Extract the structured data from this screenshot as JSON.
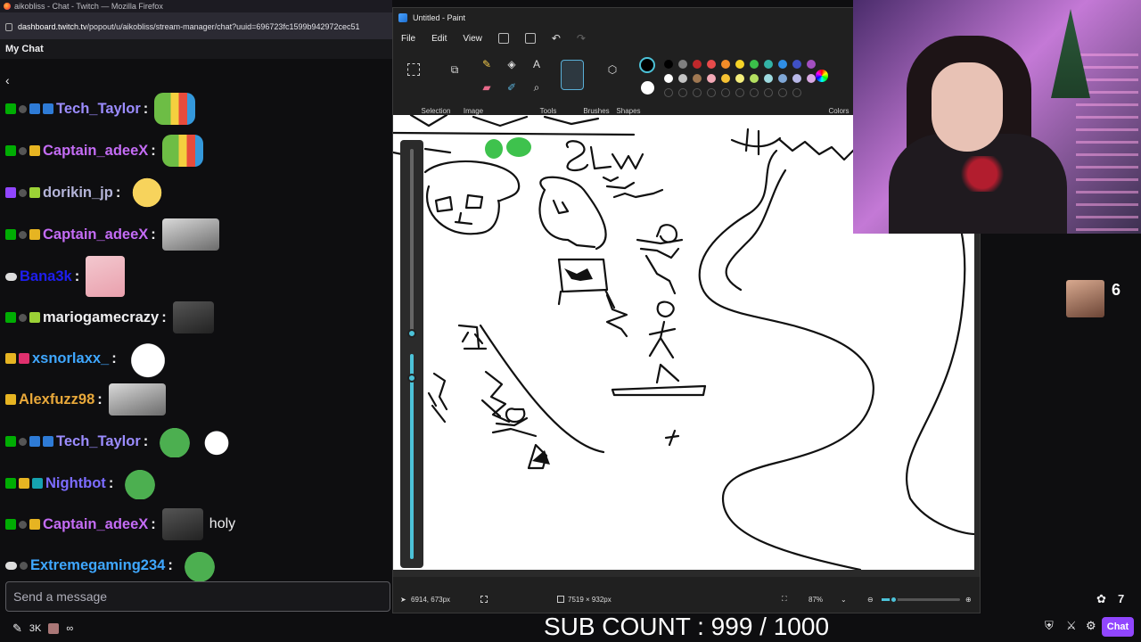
{
  "browser": {
    "title": "aikobliss - Chat - Twitch — Mozilla Firefox",
    "url_domain": "dashboard.twitch.tv",
    "url_path": "/popout/u/aikobliss/stream-manager/chat?uuid=696723fc1599b942972cec51"
  },
  "chat": {
    "header": "My Chat",
    "back_icon": "chevron-left-icon",
    "messages": [
      {
        "user": "Tech_Taylor",
        "color": "#9b8cff",
        "text": "",
        "emote": "rainbow-pepe-emote"
      },
      {
        "user": "Captain_adeeX",
        "color": "#c46cf5",
        "text": "",
        "emote": "rainbow-pepe-emote"
      },
      {
        "user": "dorikin_jp",
        "color": "#b4b4d8",
        "text": "",
        "emote": "cat-emote"
      },
      {
        "user": "Captain_adeeX",
        "color": "#c46cf5",
        "text": "",
        "emote": "man-headset-emote"
      },
      {
        "user": "Bana3k",
        "color": "#1e1ef0",
        "text": "",
        "emote": "kitten-emote"
      },
      {
        "user": "mariogamecrazy",
        "color": "#efeff1",
        "text": "",
        "emote": "stare-emote"
      },
      {
        "user": "xsnorlaxx_",
        "color": "#3fa7ff",
        "text": "",
        "emote": "ghost-emote"
      },
      {
        "user": "Alexfuzz98",
        "color": "#e8a83a",
        "text": "",
        "emote": "man-headset-emote"
      },
      {
        "user": "Tech_Taylor",
        "color": "#9b8cff",
        "text": "",
        "emote": "pepe-wave-emote"
      },
      {
        "user": "Nightbot",
        "color": "#7c6cff",
        "text": "",
        "emote": "pepe-emote"
      },
      {
        "user": "Captain_adeeX",
        "color": "#c46cf5",
        "text": "holy",
        "emote": "stare-emote"
      },
      {
        "user": "Extremegaming234",
        "color": "#3fa7ff",
        "text": "",
        "emote": "pepe-emote"
      }
    ],
    "input_placeholder": "Send a message",
    "footer_count": "3K",
    "footer_infinity": "∞"
  },
  "paint": {
    "title": "Untitled - Paint",
    "menu": [
      "File",
      "Edit",
      "View"
    ],
    "groups": {
      "selection": "Selection",
      "image": "Image",
      "tools": "Tools",
      "brushes": "Brushes",
      "shapes": "Shapes",
      "colors": "Colors"
    },
    "status": {
      "cursor": "6914, 673px",
      "canvas_size": "7519 × 932px",
      "zoom": "87%"
    },
    "palette_row1": [
      "#000000",
      "#7f7f7f",
      "#c0282b",
      "#e84b4b",
      "#f28c28",
      "#f5d327",
      "#3bbf4a",
      "#33b3a6",
      "#2f8ee5",
      "#3f50c5",
      "#a24fc0"
    ],
    "palette_row2": [
      "#ffffff",
      "#c3c3c3",
      "#a07852",
      "#f4a9b6",
      "#f7c233",
      "#f4ee7c",
      "#b4e061",
      "#9edbe0",
      "#7fa7d6",
      "#b8b8e8",
      "#d8a8e3"
    ]
  },
  "viewers": {
    "count": "6"
  },
  "right_chat_button": "Chat",
  "overlay": {
    "sub_count": "SUB COUNT : 999 / 1000"
  }
}
